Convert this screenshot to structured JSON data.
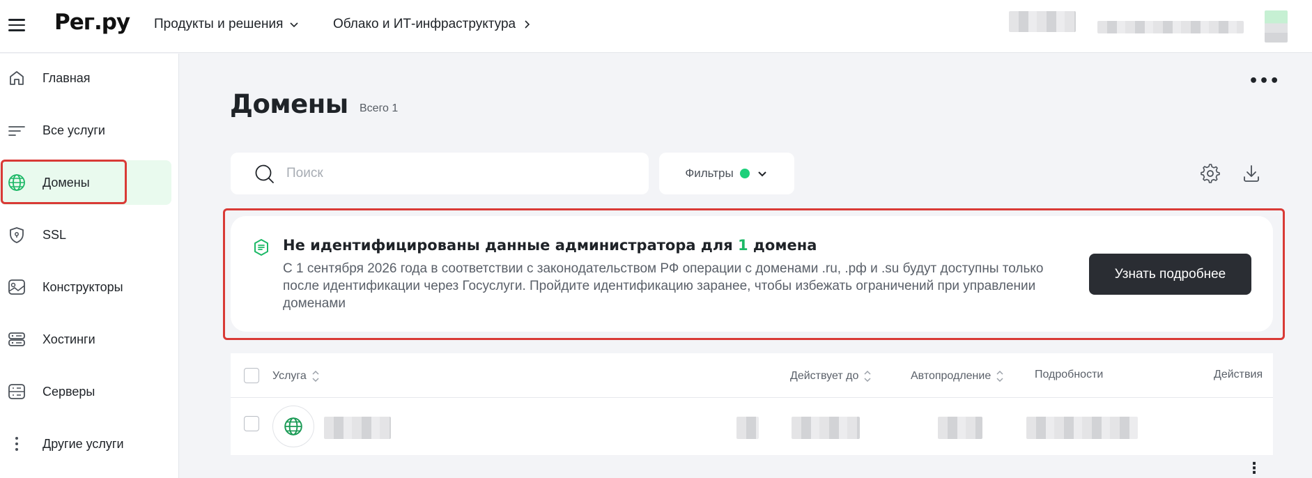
{
  "header": {
    "logo": "Рег.ру",
    "nav": [
      {
        "label": "Продукты и решения"
      },
      {
        "label": "Облако и ИТ-инфраструктура"
      }
    ]
  },
  "sidebar": {
    "items": [
      {
        "label": "Главная",
        "icon": "home-icon"
      },
      {
        "label": "Все услуги",
        "icon": "list-icon"
      },
      {
        "label": "Домены",
        "icon": "globe-icon",
        "active": true
      },
      {
        "label": "SSL",
        "icon": "shield-icon"
      },
      {
        "label": "Конструкторы",
        "icon": "constructor-icon"
      },
      {
        "label": "Хостинги",
        "icon": "hosting-icon"
      },
      {
        "label": "Серверы",
        "icon": "server-icon"
      },
      {
        "label": "Другие услуги",
        "icon": "more-vertical-icon"
      }
    ]
  },
  "main": {
    "title": "Домены",
    "total": "Всего 1",
    "search_placeholder": "Поиск",
    "filters_label": "Фильтры",
    "banner": {
      "title_before": "Не идентифицированы данные администратора для ",
      "title_count": "1",
      "title_after": " домена",
      "text": "С 1 сентября 2026 года в соответствии с законодательством РФ операции с доменами .ru, .рф и .su будут доступны только после идентификации через Госуслуги. Пройдите идентификацию заранее, чтобы избежать ограничений при управлении доменами",
      "button": "Узнать подробнее"
    },
    "table": {
      "columns": [
        "Услуга",
        "Действует до",
        "Автопродление",
        "Подробности",
        "Действия"
      ]
    }
  },
  "colors": {
    "accent_green": "#1cd07a",
    "highlight_red": "#d93a36",
    "dark_button": "#2a2d33",
    "active_bg": "#e9faee"
  }
}
